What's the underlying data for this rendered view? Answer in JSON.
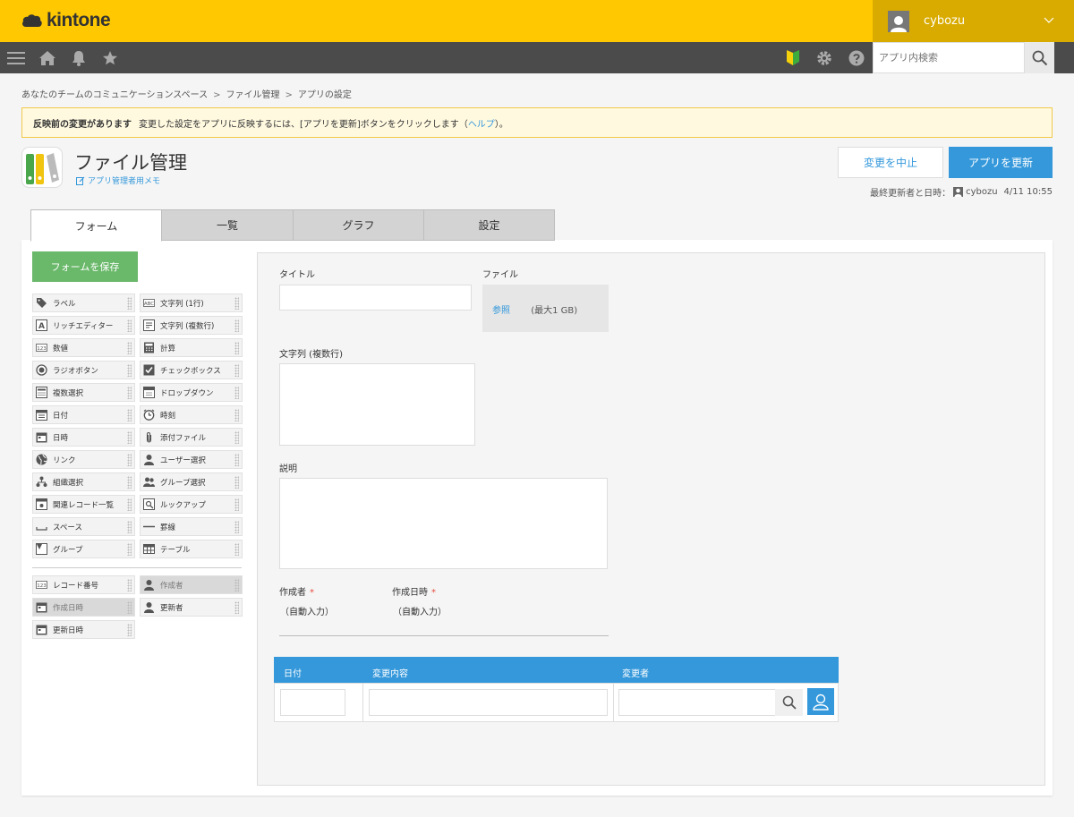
{
  "header": {
    "brand": "kintone",
    "user_name": "cybozu",
    "search_placeholder": "アプリ内検索"
  },
  "breadcrumb": [
    "あなたのチームのコミュニケーションスペース",
    "ファイル管理",
    "アプリの設定"
  ],
  "breadcrumb_separator": ">",
  "notice": {
    "title": "反映前の変更があります",
    "message": "変更した設定をアプリに反映するには、[アプリを更新]ボタンをクリックします（",
    "help_link": "ヘルプ",
    "suffix": "）。"
  },
  "app": {
    "title": "ファイル管理",
    "memo_link": "アプリ管理者用メモ"
  },
  "actions": {
    "cancel_label": "変更を中止",
    "update_label": "アプリを更新"
  },
  "last_update": {
    "label": "最終更新者と日時：",
    "user": "cybozu",
    "datetime": "4/11 10:55"
  },
  "tabs": [
    {
      "label": "フォーム",
      "active": true
    },
    {
      "label": "一覧",
      "active": false
    },
    {
      "label": "グラフ",
      "active": false
    },
    {
      "label": "設定",
      "active": false
    }
  ],
  "palette": {
    "save_label": "フォームを保存",
    "items": [
      {
        "label": "ラベル",
        "icon": "tag-icon"
      },
      {
        "label": "文字列 (1行)",
        "icon": "abc-icon"
      },
      {
        "label": "リッチエディター",
        "icon": "rich-editor-icon"
      },
      {
        "label": "文字列 (複数行)",
        "icon": "multiline-icon"
      },
      {
        "label": "数値",
        "icon": "number-icon"
      },
      {
        "label": "計算",
        "icon": "calculator-icon"
      },
      {
        "label": "ラジオボタン",
        "icon": "radio-icon"
      },
      {
        "label": "チェックボックス",
        "icon": "checkbox-icon"
      },
      {
        "label": "複数選択",
        "icon": "multiselect-icon"
      },
      {
        "label": "ドロップダウン",
        "icon": "dropdown-icon"
      },
      {
        "label": "日付",
        "icon": "calendar-icon"
      },
      {
        "label": "時刻",
        "icon": "clock-icon"
      },
      {
        "label": "日時",
        "icon": "datetime-icon"
      },
      {
        "label": "添付ファイル",
        "icon": "paperclip-icon"
      },
      {
        "label": "リンク",
        "icon": "globe-icon"
      },
      {
        "label": "ユーザー選択",
        "icon": "user-icon"
      },
      {
        "label": "組織選択",
        "icon": "org-icon"
      },
      {
        "label": "グループ選択",
        "icon": "group-icon"
      },
      {
        "label": "関連レコード一覧",
        "icon": "related-records-icon"
      },
      {
        "label": "ルックアップ",
        "icon": "lookup-icon"
      },
      {
        "label": "スペース",
        "icon": "space-icon"
      },
      {
        "label": "罫線",
        "icon": "line-icon"
      },
      {
        "label": "グループ",
        "icon": "folder-icon"
      },
      {
        "label": "テーブル",
        "icon": "table-icon"
      }
    ],
    "system_items": [
      {
        "label": "レコード番号",
        "icon": "number-icon",
        "disabled": false
      },
      {
        "label": "作成者",
        "icon": "user-icon",
        "disabled": true
      },
      {
        "label": "作成日時",
        "icon": "datetime-icon",
        "disabled": true
      },
      {
        "label": "更新者",
        "icon": "user-icon",
        "disabled": false
      },
      {
        "label": "更新日時",
        "icon": "datetime-icon",
        "disabled": false
      }
    ]
  },
  "form": {
    "title_label": "タイトル",
    "file_label": "ファイル",
    "file_browse": "参照",
    "file_max": "(最大1 GB)",
    "multiline_label": "文字列 (複数行)",
    "description_label": "説明",
    "creator_label": "作成者",
    "created_label": "作成日時",
    "required_mark": "*",
    "auto_text": "（自動入力）",
    "table_headers": [
      "日付",
      "変更内容",
      "変更者"
    ]
  },
  "colors": {
    "brand_yellow": "#ffc800",
    "nav_dark": "#4b4b4b",
    "accent_blue": "#3498db",
    "save_green": "#6ab86a"
  }
}
